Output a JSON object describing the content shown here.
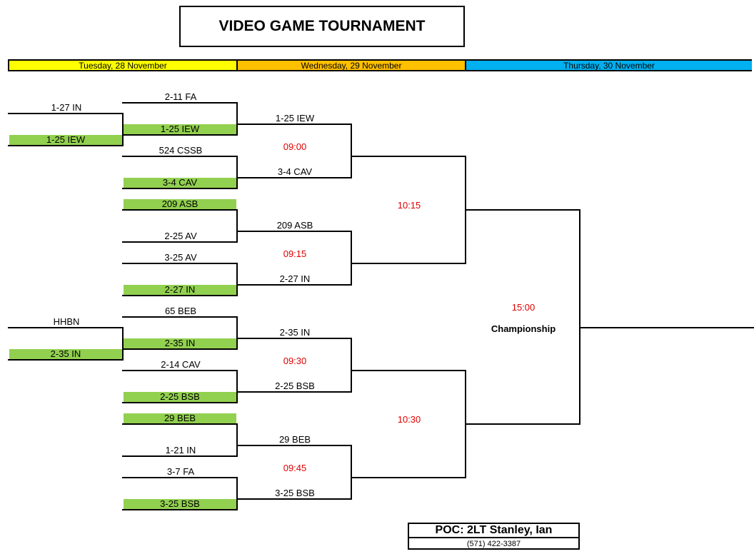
{
  "title": "VIDEO GAME TOURNAMENT",
  "days": [
    {
      "label": "Tuesday, 28 November",
      "color": "#ffff00"
    },
    {
      "label": "Wednesday, 29 November",
      "color": "#ffc000"
    },
    {
      "label": "Thursday, 30 November",
      "color": "#00b0f0"
    }
  ],
  "play_in": [
    "1-27 IN",
    "1-25 IEW",
    "HHBN",
    "2-35 IN"
  ],
  "round1": [
    "2-11 FA",
    "1-25 IEW",
    "524 CSSB",
    "3-4 CAV",
    "209 ASB",
    "2-25 AV",
    "3-25 AV",
    "2-27 IN",
    "65 BEB",
    "2-35 IN",
    "2-14 CAV",
    "2-25 BSB",
    "29 BEB",
    "1-21 IN",
    "3-7 FA",
    "3-25 BSB"
  ],
  "round2": [
    "1-25 IEW",
    "3-4 CAV",
    "209 ASB",
    "2-27 IN",
    "2-35 IN",
    "2-25 BSB",
    "29 BEB",
    "3-25 BSB"
  ],
  "round2_times": [
    "09:00",
    "09:15",
    "09:30",
    "09:45"
  ],
  "semifinal_times": [
    "10:15",
    "10:30"
  ],
  "final": {
    "time": "15:00",
    "label": "Championship"
  },
  "poc": {
    "name": "POC: 2LT Stanley, Ian",
    "phone": "(571) 422-3387"
  },
  "colors": {
    "winner": "#92d050",
    "time": "#e00000"
  }
}
